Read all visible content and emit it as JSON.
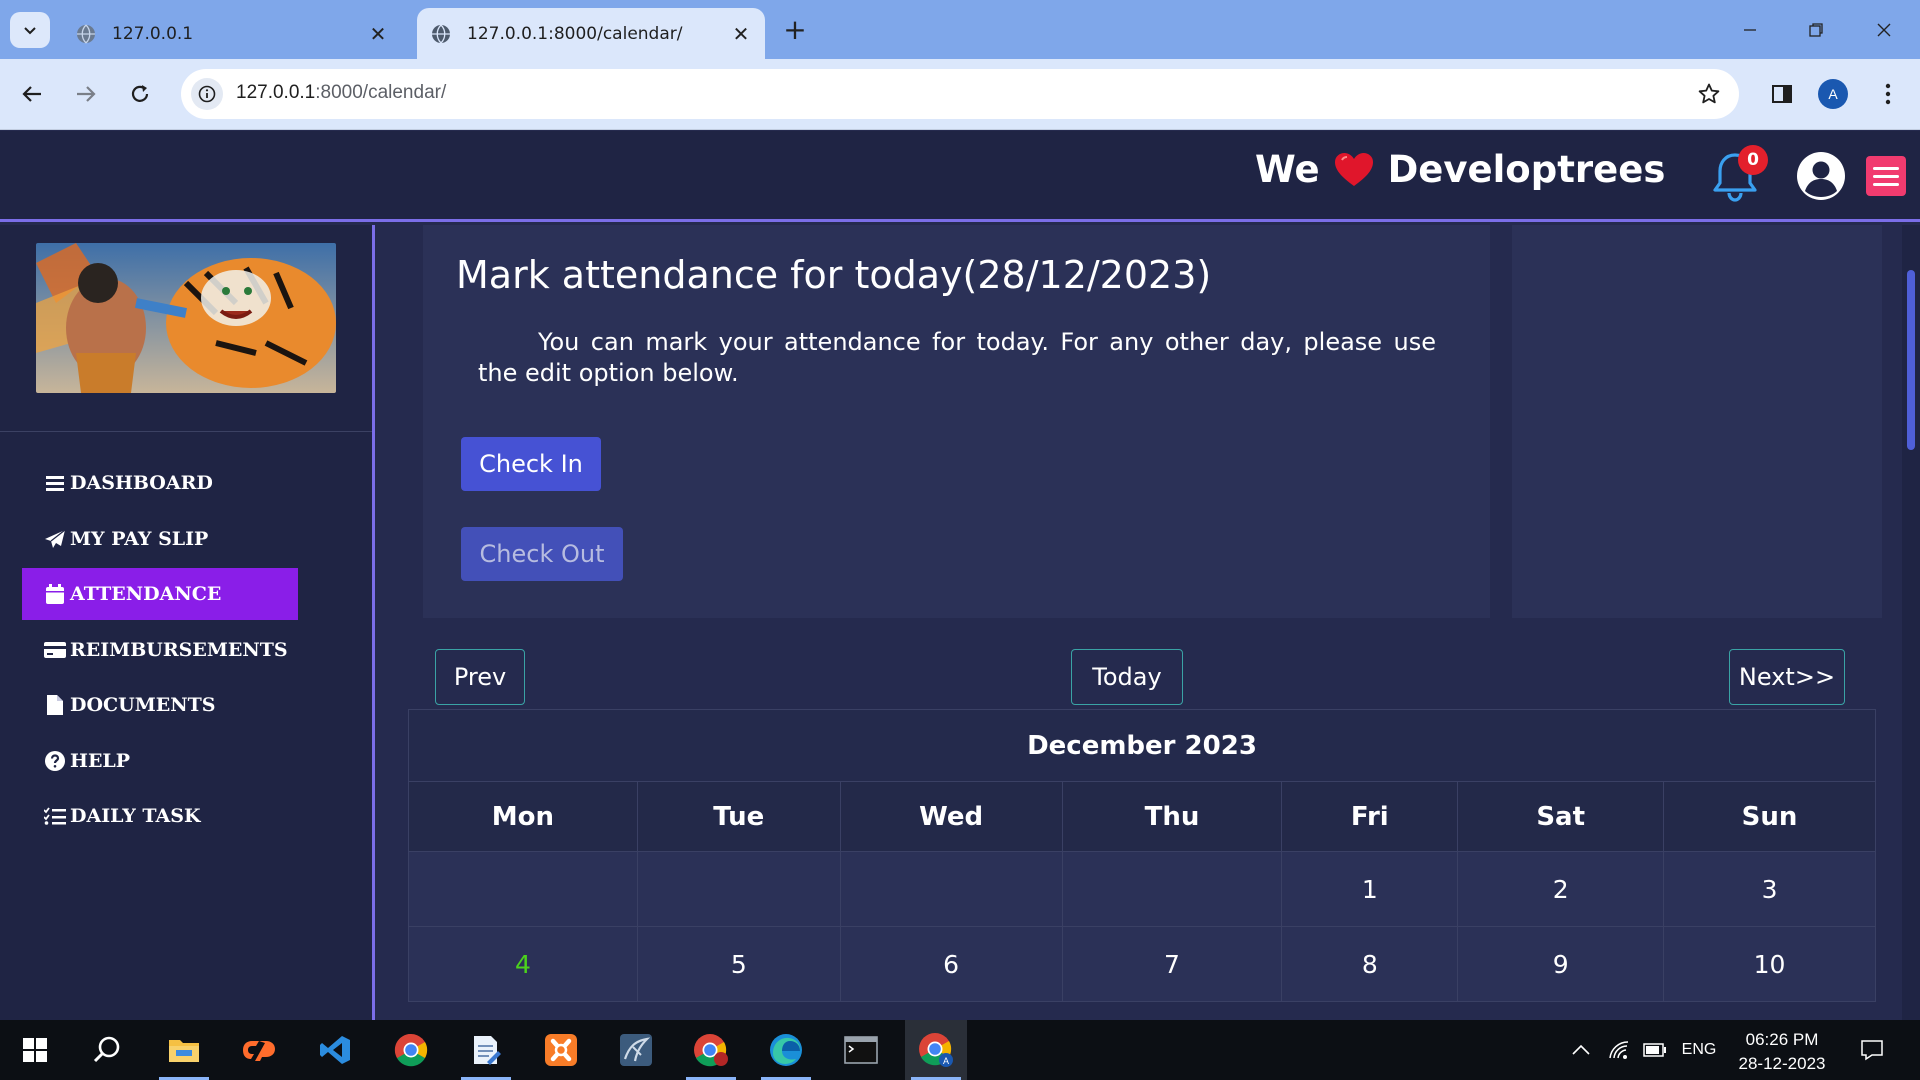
{
  "browser": {
    "tabs": [
      {
        "title": "127.0.0.1",
        "active": false
      },
      {
        "title": "127.0.0.1:8000/calendar/",
        "active": true
      }
    ],
    "url_host": "127.0.0.1",
    "url_rest": ":8000/calendar/",
    "profile_initial": "A"
  },
  "header": {
    "brand_left": "We",
    "brand_right": "Developtrees",
    "notification_count": "0",
    "accent": "#7b6ee8"
  },
  "sidebar": {
    "items": [
      {
        "label": "DASHBOARD",
        "icon": "bars-icon",
        "active": false
      },
      {
        "label": "MY PAY SLIP",
        "icon": "paper-plane-icon",
        "active": false
      },
      {
        "label": "ATTENDANCE",
        "icon": "calendar-icon",
        "active": true
      },
      {
        "label": "REIMBURSEMENTS",
        "icon": "credit-card-icon",
        "active": false
      },
      {
        "label": "DOCUMENTS",
        "icon": "file-icon",
        "active": false
      },
      {
        "label": "HELP",
        "icon": "question-circle-icon",
        "active": false
      },
      {
        "label": "DAILY TASK",
        "icon": "list-check-icon",
        "active": false
      }
    ]
  },
  "attendance": {
    "title": "Mark attendance for today(28/12/2023)",
    "description": "You can mark your attendance for today. For any other day, please use the edit option below.",
    "check_in_label": "Check In",
    "check_out_label": "Check Out"
  },
  "calendar": {
    "prev_label": "Prev",
    "today_label": "Today",
    "next_label": "Next>>",
    "month_title": "December 2023",
    "weekdays": [
      "Mon",
      "Tue",
      "Wed",
      "Thu",
      "Fri",
      "Sat",
      "Sun"
    ],
    "weeks": [
      [
        "",
        "",
        "",
        "",
        "1",
        "2",
        "3"
      ],
      [
        "4",
        "5",
        "6",
        "7",
        "8",
        "9",
        "10"
      ]
    ],
    "highlighted_day": "4"
  },
  "taskbar": {
    "language": "ENG",
    "time": "06:26 PM",
    "date": "28-12-2023"
  }
}
